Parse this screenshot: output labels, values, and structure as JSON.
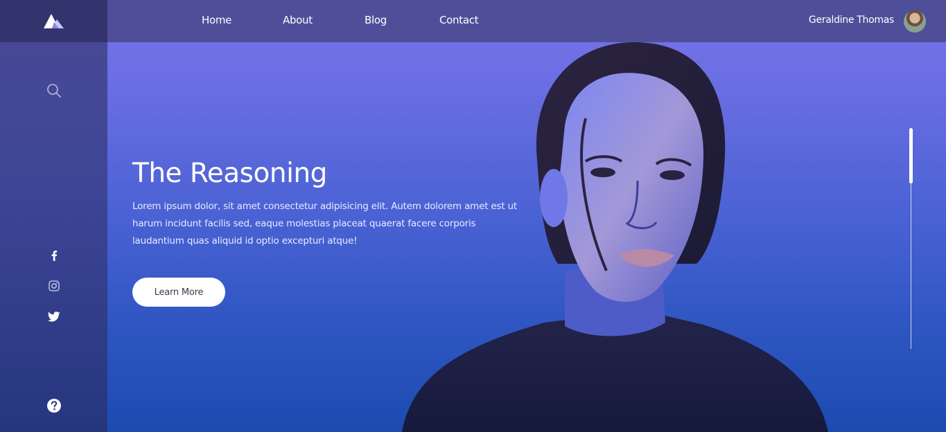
{
  "brand": {
    "logo_icon": "mountain-logo-icon"
  },
  "nav": {
    "items": [
      {
        "label": "Home"
      },
      {
        "label": "About"
      },
      {
        "label": "Blog"
      },
      {
        "label": "Contact"
      }
    ]
  },
  "user": {
    "name": "Geraldine Thomas",
    "avatar_icon": "user-avatar"
  },
  "sidebar": {
    "search_icon": "search-icon",
    "social": [
      "facebook-icon",
      "instagram-icon",
      "twitter-icon"
    ],
    "help_icon": "help-icon"
  },
  "hero": {
    "title": "The Reasoning",
    "body": "Lorem ipsum dolor, sit amet consectetur adipisicing elit. Autem dolorem amet est ut harum incidunt facilis sed, eaque molestias placeat quaerat facere corporis laudantium quas aliquid id optio excepturi atque!",
    "cta_label": "Learn More"
  },
  "colors": {
    "sidebar": "#3d4596",
    "topbar": "#4f4f99",
    "hero_top": "#7a72ea",
    "hero_bottom": "#1c4bb0",
    "button": "#ffffff"
  },
  "scroll": {
    "position": 0.0
  }
}
